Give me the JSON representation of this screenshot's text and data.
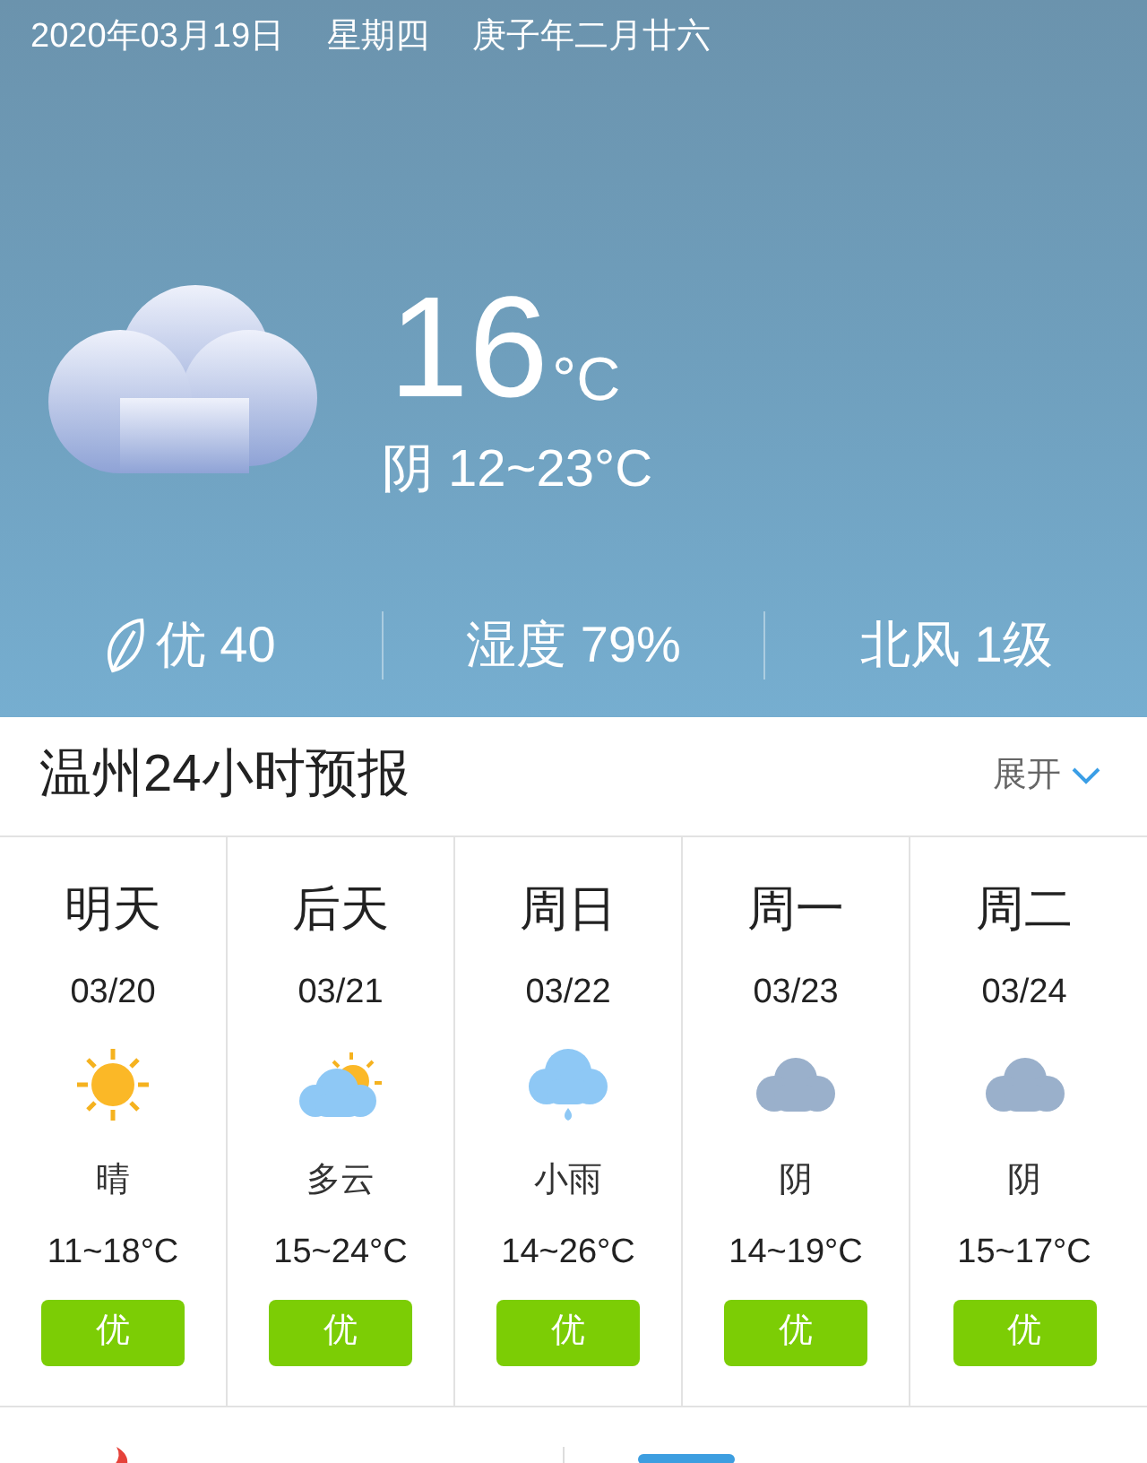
{
  "header": {
    "date": "2020年03月19日",
    "weekday": "星期四",
    "lunar_date": "庚子年二月廿六"
  },
  "current": {
    "kind": "cloudy",
    "temperature": "16",
    "unit": "°C",
    "condition": "阴 12~23°C"
  },
  "stats": [
    {
      "kind": "air",
      "text": "优 40"
    },
    {
      "kind": "plain",
      "text": "湿度 79%"
    },
    {
      "kind": "plain",
      "text": "北风 1级"
    }
  ],
  "forecast_section": {
    "title": "温州24小时预报",
    "toggle": "展开"
  },
  "days": [
    {
      "day": "明天",
      "date": "03/20",
      "kind": "sunny",
      "condition": "晴",
      "range": "11~18°C",
      "aqi": "优"
    },
    {
      "day": "后天",
      "date": "03/21",
      "kind": "partly_cloudy",
      "condition": "多云",
      "range": "15~24°C",
      "aqi": "优"
    },
    {
      "day": "周日",
      "date": "03/22",
      "kind": "rain",
      "condition": "小雨",
      "range": "14~26°C",
      "aqi": "优"
    },
    {
      "day": "周一",
      "date": "03/23",
      "kind": "overcast",
      "condition": "阴",
      "range": "14~19°C",
      "aqi": "优"
    },
    {
      "day": "周二",
      "date": "03/24",
      "kind": "overcast",
      "condition": "阴",
      "range": "15~17°C",
      "aqi": "优"
    }
  ]
}
